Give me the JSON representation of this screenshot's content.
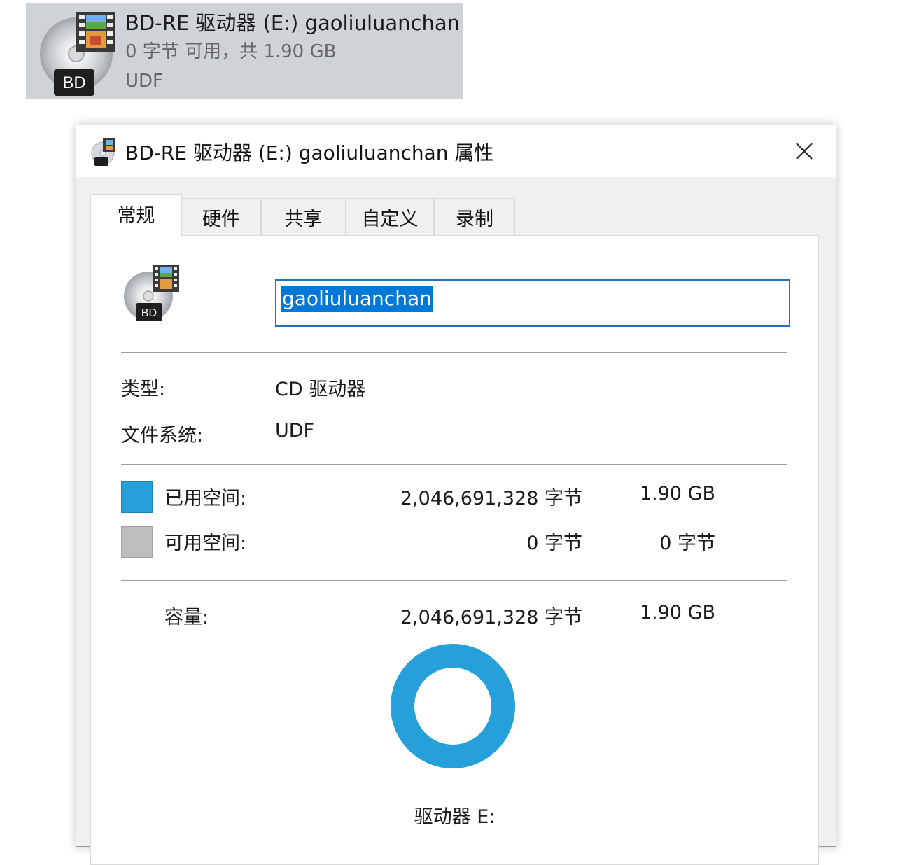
{
  "tile": {
    "name": "BD-RE 驱动器 (E:) gaoliuluanchan",
    "space": "0 字节 可用，共 1.90 GB",
    "filesystem": "UDF",
    "badge": "BD",
    "icon": "bd-disc-icon"
  },
  "dialog": {
    "title": "BD-RE 驱动器 (E:) gaoliuluanchan 属性",
    "close_icon": "close-icon",
    "tabs": [
      {
        "label": "常规",
        "active": true
      },
      {
        "label": "硬件",
        "active": false
      },
      {
        "label": "共享",
        "active": false
      },
      {
        "label": "自定义",
        "active": false
      },
      {
        "label": "录制",
        "active": false
      }
    ],
    "badge": "BD",
    "name_value": "gaoliuluanchan",
    "type_label": "类型:",
    "type_value": "CD 驱动器",
    "fs_label": "文件系统:",
    "fs_value": "UDF",
    "used": {
      "label": "已用空间:",
      "bytes": "2,046,691,328 字节",
      "size": "1.90 GB",
      "color": "#26a0da"
    },
    "free": {
      "label": "可用空间:",
      "bytes": "0 字节",
      "size": "0 字节",
      "color": "#bdbdbd"
    },
    "capacity": {
      "label": "容量:",
      "bytes": "2,046,691,328 字节",
      "size": "1.90 GB"
    },
    "used_fraction": 1.0,
    "drive_label": "驱动器 E:"
  }
}
